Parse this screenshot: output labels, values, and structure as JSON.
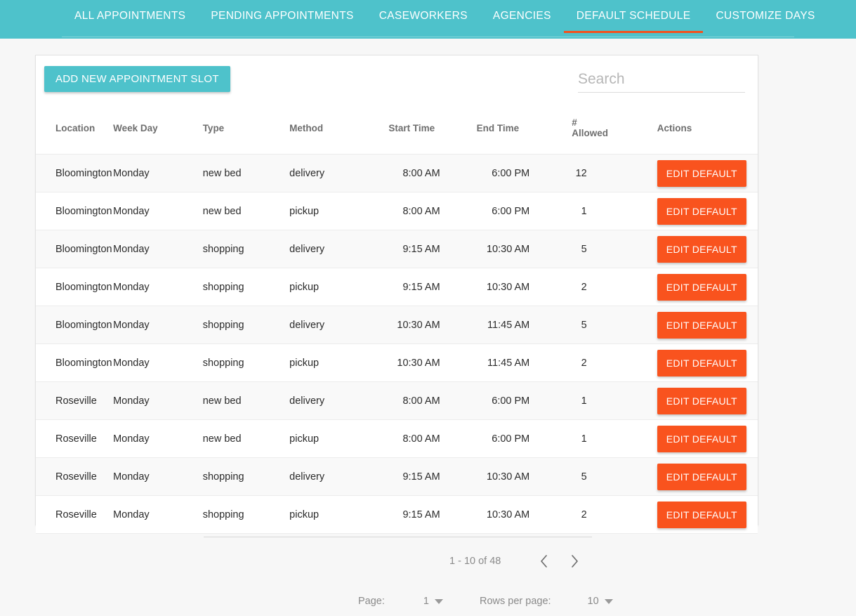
{
  "theme": {
    "teal": "#4ec2cb",
    "orange": "#f9531e",
    "page_bg": "#f7f7f7",
    "card_bg": "#ffffff"
  },
  "tabs": [
    {
      "label": "ALL APPOINTMENTS",
      "active": false
    },
    {
      "label": "PENDING APPOINTMENTS",
      "active": false
    },
    {
      "label": "CASEWORKERS",
      "active": false
    },
    {
      "label": "AGENCIES",
      "active": false
    },
    {
      "label": "DEFAULT SCHEDULE",
      "active": true
    },
    {
      "label": "CUSTOMIZE DAYS",
      "active": false
    }
  ],
  "toolbar": {
    "add_label": "ADD NEW APPOINTMENT SLOT",
    "search_placeholder": "Search",
    "search_value": ""
  },
  "table": {
    "columns": [
      "Location",
      "Week Day",
      "Type",
      "Method",
      "Start Time",
      "End Time",
      "# Allowed",
      "Actions"
    ],
    "action_label": "EDIT DEFAULT",
    "rows": [
      {
        "location": "Bloomington",
        "week_day": "Monday",
        "type": "new bed",
        "method": "delivery",
        "start": "8:00 AM",
        "end": "6:00 PM",
        "allowed": "12"
      },
      {
        "location": "Bloomington",
        "week_day": "Monday",
        "type": "new bed",
        "method": "pickup",
        "start": "8:00 AM",
        "end": "6:00 PM",
        "allowed": "1"
      },
      {
        "location": "Bloomington",
        "week_day": "Monday",
        "type": "shopping",
        "method": "delivery",
        "start": "9:15 AM",
        "end": "10:30 AM",
        "allowed": "5"
      },
      {
        "location": "Bloomington",
        "week_day": "Monday",
        "type": "shopping",
        "method": "pickup",
        "start": "9:15 AM",
        "end": "10:30 AM",
        "allowed": "2"
      },
      {
        "location": "Bloomington",
        "week_day": "Monday",
        "type": "shopping",
        "method": "delivery",
        "start": "10:30 AM",
        "end": "11:45 AM",
        "allowed": "5"
      },
      {
        "location": "Bloomington",
        "week_day": "Monday",
        "type": "shopping",
        "method": "pickup",
        "start": "10:30 AM",
        "end": "11:45 AM",
        "allowed": "2"
      },
      {
        "location": "Roseville",
        "week_day": "Monday",
        "type": "new bed",
        "method": "delivery",
        "start": "8:00 AM",
        "end": "6:00 PM",
        "allowed": "1"
      },
      {
        "location": "Roseville",
        "week_day": "Monday",
        "type": "new bed",
        "method": "pickup",
        "start": "8:00 AM",
        "end": "6:00 PM",
        "allowed": "1"
      },
      {
        "location": "Roseville",
        "week_day": "Monday",
        "type": "shopping",
        "method": "delivery",
        "start": "9:15 AM",
        "end": "10:30 AM",
        "allowed": "5"
      },
      {
        "location": "Roseville",
        "week_day": "Monday",
        "type": "shopping",
        "method": "pickup",
        "start": "9:15 AM",
        "end": "10:30 AM",
        "allowed": "2"
      }
    ]
  },
  "pagination": {
    "range_text": "1 - 10 of 48",
    "prev_icon": "chevron-left-icon",
    "next_icon": "chevron-right-icon",
    "page_label": "Page:",
    "page_value": "1",
    "rows_label": "Rows per page:",
    "rows_value": "10"
  }
}
